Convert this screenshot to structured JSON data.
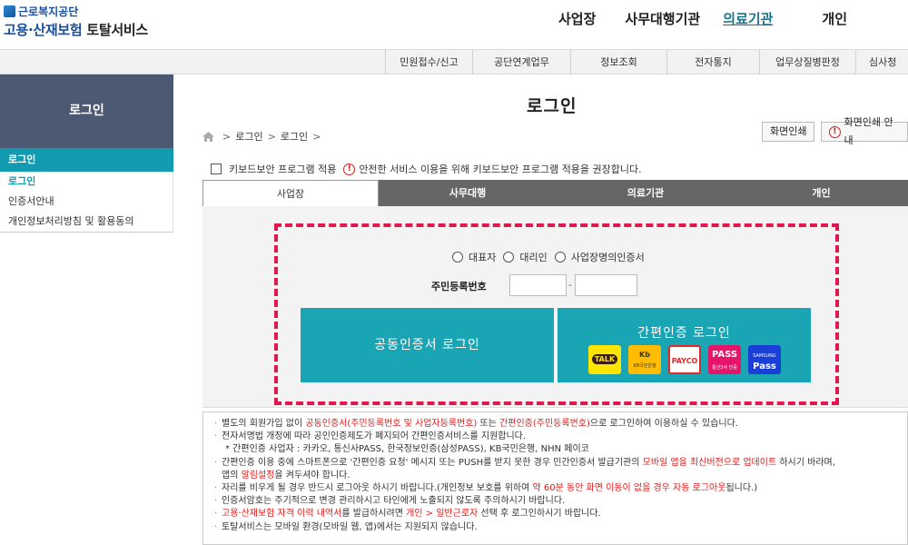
{
  "header": {
    "logo_top": "근로복지공단",
    "logo_main": "고용·산재보험",
    "logo_total": "토탈서비스",
    "nav": [
      "사업장",
      "사무대행기관",
      "의료기관",
      "개인"
    ]
  },
  "subnav": [
    "민원접수/신고",
    "공단연계업무",
    "정보조회",
    "전자통지",
    "업무상질병판정",
    "심사청"
  ],
  "sidebar": {
    "title": "로그인",
    "section": "로그인",
    "items": [
      "로그인",
      "인증서안내",
      "개인정보처리방침 및 활용동의"
    ]
  },
  "main": {
    "title": "로그인",
    "breadcrumb": [
      "로그인",
      "로그인"
    ],
    "print_label": "화면인쇄",
    "print_guide_label": "화면인쇄 안내",
    "keyboard_label": "키보드보안 프로그램 적용",
    "keyboard_note": "안전한 서비스 이용을 위해 키보드보안 프로그램 적용을 권장합니다.",
    "tabs": [
      "사업장",
      "사무대행",
      "의료기관",
      "개인"
    ],
    "radios": [
      "대표자",
      "대리인",
      "사업장명의인증서"
    ],
    "rrn_label": "주민등록번호",
    "rrn_dash": "-",
    "cert_login": "공동인증서 로그인",
    "simple_login": "간편인증 로그인",
    "providers": {
      "kakao": "TALK",
      "kb": "Kb",
      "kb_sub": "KB국민은행",
      "payco": "PAYCO",
      "pass": "PASS",
      "pass_sub": "통신3사 인증",
      "samsung_top": "SAMSUNG",
      "samsung": "Pass"
    }
  },
  "notice": {
    "l1a": "별도의 회원가입 없이 ",
    "l1b": "공동인증서(주민등록번호 및 사업자등록번호)",
    "l1c": " 또는 ",
    "l1d": "간편인증(주민등록번호)",
    "l1e": "으로 로그인하여 이용하실 수 있습니다.",
    "l2": "전자서명법 개정에 따라 공인인증제도가 폐지되어 간편인증서비스를 지원합니다.",
    "l3": "* 간편인증 사업자 : 카카오, 통신사PASS, 한국정보인증(삼성PASS), KB국민은행, NHN 페이코",
    "l4a": "간편인증 이용 중에 스마트폰으로 '간편인증 요청' 메시지 또는 PUSH를 받지 못한 경우 민간인증서 발급기관의 ",
    "l4b": "모바일 앱을 최신버전으로 업데이트",
    "l4c": " 하시기 바라며,",
    "l5a": "앱의 ",
    "l5b": "알림설정",
    "l5c": "을 켜두셔야 합니다.",
    "l6a": "자리를 비우게 될 경우 반드시 로그아웃 하시기 바랍니다.(개인정보 보호를 위하여 ",
    "l6b": "약 60분 동안 화면 이동이 없을 경우 자동 로그아웃",
    "l6c": "됩니다.)",
    "l7": "인증서암호는 주기적으로 변경 관리하시고 타인에게 노출되지 않도록 주의하시기 바랍니다.",
    "l8a": "고용·산재보험 자격 이력 내역서",
    "l8b": "를 발급하시려면 ",
    "l8c": "개인 > 일반근로자",
    "l8d": " 선택 후 로그인하시기 바랍니다.",
    "l9": "토탈서비스는 모바일 환경(모바일 웹, 앱)에서는 지원되지 않습니다."
  }
}
